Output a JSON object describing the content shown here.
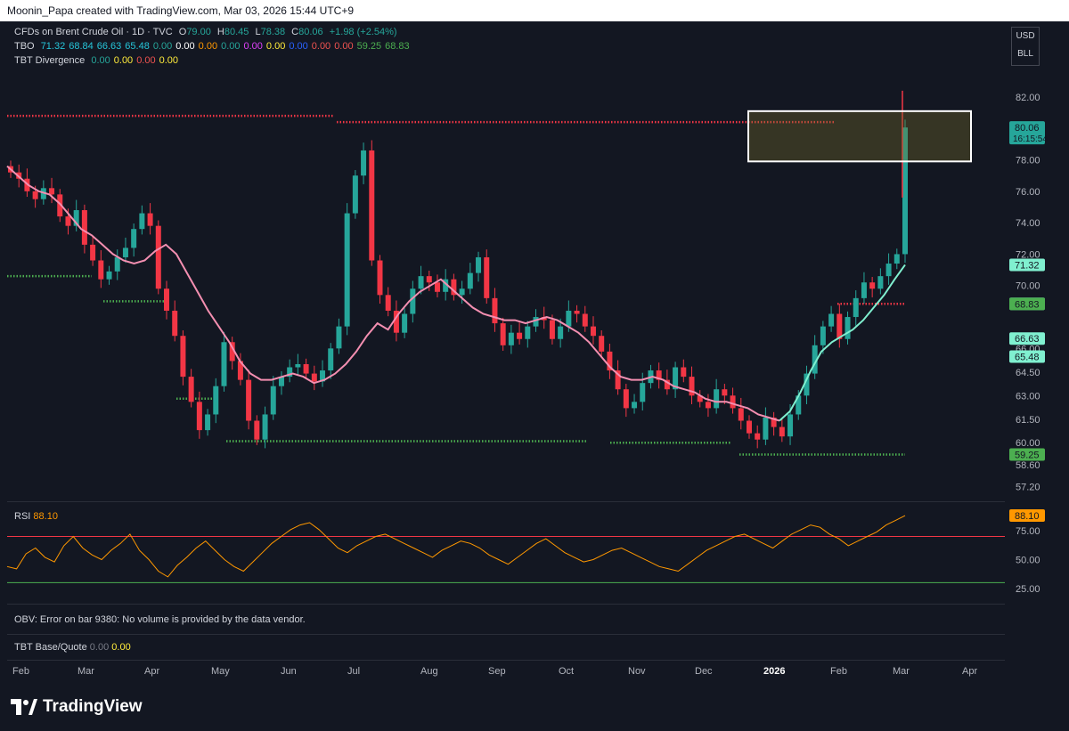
{
  "header": {
    "text": "Moonin_Papa created with TradingView.com, Mar 03, 2026 15:44 UTC+9"
  },
  "legend": {
    "symbol": "CFDs on Brent Crude Oil · 1D · TVC",
    "o_label": "O",
    "o": "79.00",
    "h_label": "H",
    "h": "80.45",
    "l_label": "L",
    "l": "78.38",
    "c_label": "C",
    "c": "80.06",
    "change": "+1.98 (+2.54%)",
    "tbo_label": "TBO",
    "tbo_values": [
      "71.32",
      "68.84",
      "66.63",
      "65.48",
      "0.00",
      "0.00",
      "0.00",
      "0.00",
      "0.00",
      "0.00",
      "0.00",
      "0.00",
      "0.00",
      "59.25",
      "68.83"
    ],
    "tbo_colors": [
      "#26c6da",
      "#26c6da",
      "#26c6da",
      "#26c6da",
      "#26a69a",
      "#ffffff",
      "#ff9800",
      "#26a69a",
      "#e040fb",
      "#ffeb3b",
      "#2962ff",
      "#ef5350",
      "#ef5350",
      "#4caf50",
      "#4caf50"
    ],
    "div_label": "TBT Divergence",
    "div_values": [
      "0.00",
      "0.00",
      "0.00",
      "0.00"
    ],
    "div_colors": [
      "#26a69a",
      "#ffeb3b",
      "#ef5350",
      "#ffeb3b"
    ]
  },
  "currency": {
    "usd": "USD",
    "unit": "BLL"
  },
  "rsi": {
    "label": "RSI",
    "value": "88.10"
  },
  "obv": {
    "text": "OBV: Error on bar 9380: No volume is provided by the data vendor."
  },
  "base_quote": {
    "label": "TBT Base/Quote",
    "v1": "0.00",
    "v2": "0.00"
  },
  "brand": {
    "name": "TradingView"
  },
  "colors": {
    "up": "#26a69a",
    "down": "#f23645",
    "mint": "#80f0d0",
    "pink": "#f48fb1",
    "rsi": "#ff9800"
  },
  "chart_data": {
    "type": "candlestick",
    "title": "CFDs on Brent Crude Oil · 1D · TVC",
    "y_ticks": [
      82.0,
      80.06,
      78.0,
      76.0,
      74.0,
      72.0,
      70.0,
      68.84,
      66.0,
      64.5,
      63.0,
      61.5,
      60.0,
      58.6,
      57.2
    ],
    "ylim": [
      56.5,
      83.3
    ],
    "x_ticks": [
      "Feb",
      "Mar",
      "Apr",
      "May",
      "Jun",
      "Jul",
      "Aug",
      "Sep",
      "Oct",
      "Nov",
      "Dec",
      "2026",
      "Feb",
      "Mar",
      "Apr"
    ],
    "price_labels": [
      {
        "text": "80.06",
        "sub": "16:15:54",
        "value": 80.06,
        "color": "#26a69a"
      },
      {
        "text": "71.32",
        "value": 71.32,
        "color": "#80f0d0"
      },
      {
        "text": "68.84",
        "value": 68.84,
        "color": "#80f0d0"
      },
      {
        "text": "68.83",
        "value": 68.83,
        "color": "#4caf50"
      },
      {
        "text": "66.63",
        "value": 66.63,
        "color": "#80f0d0"
      },
      {
        "text": "65.48",
        "value": 65.48,
        "color": "#80f0d0"
      },
      {
        "text": "59.25",
        "value": 59.25,
        "color": "#4caf50"
      }
    ],
    "close_series": [
      77.2,
      76.8,
      76.0,
      75.5,
      76.2,
      75.8,
      74.4,
      73.8,
      74.8,
      72.6,
      71.6,
      70.4,
      70.9,
      71.8,
      72.4,
      73.6,
      74.6,
      73.8,
      69.8,
      68.4,
      66.8,
      64.2,
      62.6,
      60.8,
      61.8,
      63.6,
      66.4,
      65.2,
      64.0,
      61.4,
      60.2,
      61.8,
      63.6,
      64.2,
      64.8,
      65.0,
      64.4,
      63.9,
      64.6,
      66.0,
      67.4,
      74.6,
      77.0,
      78.6,
      71.6,
      69.4,
      68.4,
      67.0,
      68.2,
      69.8,
      70.6,
      70.2,
      69.6,
      70.4,
      69.4,
      69.8,
      70.8,
      71.8,
      69.2,
      67.6,
      66.2,
      67.0,
      66.6,
      67.4,
      68.0,
      67.8,
      66.6,
      67.4,
      68.4,
      68.2,
      67.4,
      66.8,
      65.8,
      64.6,
      63.4,
      62.2,
      62.6,
      63.8,
      64.6,
      64.0,
      63.4,
      64.8,
      64.2,
      63.0,
      62.6,
      62.2,
      63.4,
      63.0,
      62.2,
      61.4,
      60.6,
      60.2,
      61.6,
      61.0,
      60.4,
      61.8,
      63.0,
      64.4,
      66.2,
      67.4,
      68.2,
      66.6,
      68.0,
      69.2,
      70.2,
      69.8,
      70.6,
      71.4,
      72.0,
      80.06
    ],
    "overlay_lines": [
      {
        "name": "",
        "color": "#f48fb1",
        "values": [
          77.6,
          77.0,
          76.4,
          76.0,
          75.8,
          75.2,
          74.4,
          73.6,
          73.2,
          72.6,
          72.0,
          71.6,
          71.4,
          71.6,
          72.2,
          72.6,
          72.0,
          70.8,
          69.6,
          68.4,
          67.4,
          66.4,
          65.2,
          64.4,
          64.0,
          64.0,
          64.2,
          64.4,
          64.2,
          63.8,
          64.0,
          64.4,
          65.0,
          65.8,
          66.8,
          67.6,
          67.2,
          68.2,
          69.0,
          69.6,
          70.0,
          70.4,
          69.8,
          69.2,
          68.6,
          68.2,
          68.0,
          67.8,
          67.8,
          67.6,
          67.8,
          68.0,
          67.8,
          67.4,
          67.0,
          66.4,
          65.6,
          64.8,
          64.2,
          64.0,
          64.0,
          64.2,
          64.0,
          63.6,
          63.4,
          63.2,
          62.8,
          62.6,
          62.6,
          62.4,
          62.2,
          61.8,
          61.6,
          61.4
        ]
      },
      {
        "name": "",
        "color": "#80f0d0",
        "values": [
          61.4,
          62.0,
          63.2,
          64.6,
          65.8,
          66.4,
          66.8,
          67.2,
          67.8,
          68.6,
          69.4,
          70.4,
          71.32
        ]
      }
    ],
    "horizontal_levels": [
      {
        "value": 80.8,
        "color": "#f23645"
      },
      {
        "value": 80.4,
        "color": "#f23645"
      },
      {
        "value": 70.6,
        "color": "#4caf50"
      },
      {
        "value": 69.0,
        "color": "#4caf50"
      },
      {
        "value": 62.8,
        "color": "#4caf50"
      },
      {
        "value": 60.1,
        "color": "#4caf50"
      },
      {
        "value": 60.0,
        "color": "#4caf50"
      },
      {
        "value": 59.25,
        "color": "#4caf50"
      },
      {
        "value": 68.84,
        "color": "#f23645"
      }
    ],
    "rsi_series": [
      44,
      42,
      55,
      60,
      52,
      48,
      62,
      70,
      60,
      54,
      50,
      58,
      64,
      72,
      58,
      50,
      40,
      35,
      45,
      52,
      60,
      66,
      58,
      50,
      44,
      40,
      48,
      56,
      64,
      70,
      76,
      80,
      82,
      76,
      68,
      60,
      56,
      62,
      66,
      70,
      72,
      68,
      64,
      60,
      56,
      52,
      58,
      62,
      66,
      64,
      60,
      54,
      50,
      46,
      52,
      58,
      64,
      68,
      62,
      56,
      52,
      48,
      50,
      54,
      58,
      60,
      56,
      52,
      48,
      44,
      42,
      40,
      46,
      52,
      58,
      62,
      66,
      70,
      72,
      68,
      64,
      60,
      66,
      72,
      76,
      80,
      78,
      72,
      68,
      62,
      66,
      70,
      74,
      80,
      84,
      88.1
    ],
    "rsi_levels": [
      70,
      30
    ],
    "rsi_ticks": [
      "75.00",
      "50.00",
      "25.00"
    ],
    "rsi_ylim": [
      18,
      92
    ]
  }
}
